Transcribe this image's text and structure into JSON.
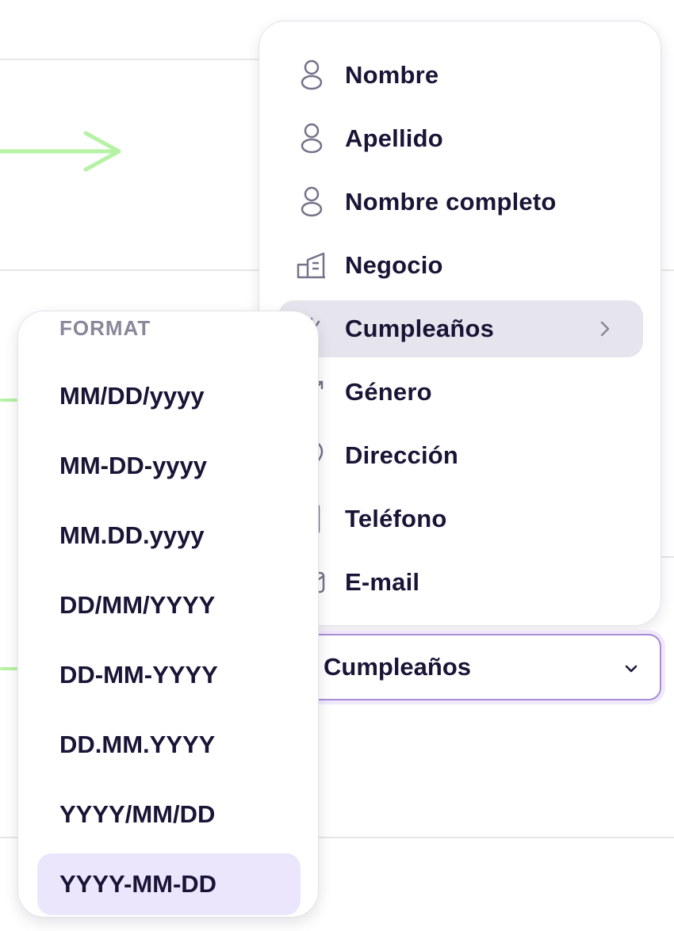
{
  "field_menu": {
    "items": [
      {
        "label": "Nombre",
        "icon": "user-icon"
      },
      {
        "label": "Apellido",
        "icon": "user-icon"
      },
      {
        "label": "Nombre completo",
        "icon": "user-icon"
      },
      {
        "label": "Negocio",
        "icon": "building-icon"
      },
      {
        "label": "Cumpleaños",
        "icon": "birthday-icon",
        "active": true,
        "has_submenu": true
      },
      {
        "label": "Género",
        "icon": "gender-icon"
      },
      {
        "label": "Dirección",
        "icon": "location-icon"
      },
      {
        "label": "Teléfono",
        "icon": "phone-icon"
      },
      {
        "label": "E-mail",
        "icon": "mail-icon"
      }
    ]
  },
  "select": {
    "value": "Cumpleaños"
  },
  "format_menu": {
    "heading": "FORMAT",
    "options": [
      "MM/DD/yyyy",
      "MM-DD-yyyy",
      "MM.DD.yyyy",
      "DD/MM/YYYY",
      "DD-MM-YYYY",
      "DD.MM.YYYY",
      "YYYY/MM/DD",
      "YYYY-MM-DD"
    ],
    "selected_index": 7
  },
  "colors": {
    "accent_green": "#b6f2a4",
    "select_border": "#a98bd8",
    "active_field": "#e6e4ec",
    "active_format": "#ece6fd",
    "text": "#1a1436"
  }
}
